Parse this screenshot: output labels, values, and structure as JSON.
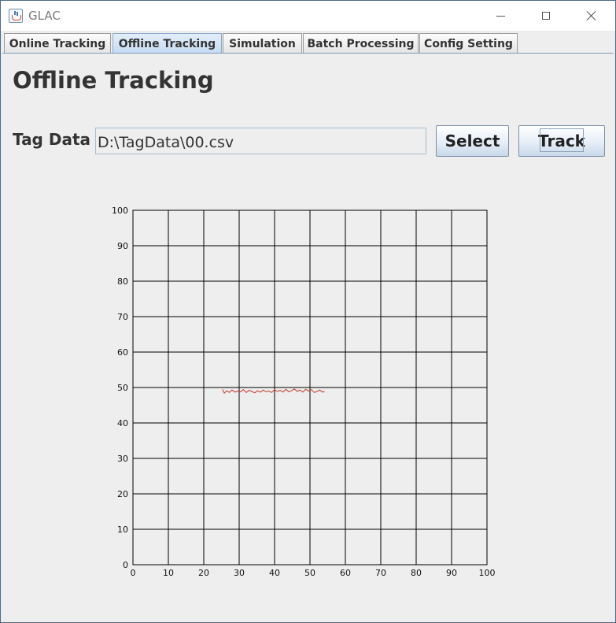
{
  "window": {
    "title": "GLAC",
    "icon": "java-cup-icon"
  },
  "tabs": [
    {
      "label": "Online Tracking",
      "selected": false
    },
    {
      "label": "Offline Tracking",
      "selected": true
    },
    {
      "label": "Simulation",
      "selected": false
    },
    {
      "label": "Batch Processing",
      "selected": false
    },
    {
      "label": "Config Setting",
      "selected": false
    }
  ],
  "page": {
    "title": "Offline Tracking",
    "tag_data_label": "Tag Data",
    "tag_data_value": "D:\\TagData\\00.csv",
    "select_label": "Select",
    "track_label": "Track"
  },
  "colors": {
    "tab_selected": "#c5dbf2",
    "track_line": "#c0392b",
    "grid": "#000000"
  },
  "chart_data": {
    "type": "line",
    "xlim": [
      0,
      100
    ],
    "ylim": [
      0,
      100
    ],
    "xticks": [
      "0",
      "10",
      "20",
      "30",
      "40",
      "50",
      "60",
      "70",
      "80",
      "90",
      "100"
    ],
    "yticks": [
      "0",
      "10",
      "20",
      "30",
      "40",
      "50",
      "60",
      "70",
      "80",
      "90",
      "100"
    ],
    "grid": true,
    "series": [
      {
        "color": "#c0392b",
        "x": [
          25.3,
          25.8,
          26.5,
          27.2,
          28.0,
          28.8,
          29.6,
          30.4,
          31.2,
          32.0,
          32.8,
          33.6,
          34.4,
          35.2,
          36.0,
          36.8,
          37.6,
          38.4,
          39.2,
          40.0,
          40.8,
          41.6,
          42.4,
          43.2,
          44.0,
          44.8,
          45.6,
          46.4,
          47.2,
          48.0,
          48.8,
          49.6,
          50.4,
          51.2,
          52.0,
          52.8,
          53.6,
          54.1
        ],
        "y": [
          49.5,
          48.4,
          49.1,
          48.6,
          49.3,
          48.7,
          49.0,
          48.8,
          49.4,
          48.6,
          49.2,
          48.9,
          48.5,
          49.1,
          48.7,
          49.3,
          48.8,
          49.0,
          48.6,
          49.4,
          48.9,
          49.2,
          48.7,
          49.5,
          48.8,
          49.1,
          49.6,
          48.9,
          49.3,
          48.7,
          49.5,
          49.0,
          49.4,
          48.6,
          48.9,
          49.3,
          48.7,
          48.9
        ]
      }
    ]
  }
}
